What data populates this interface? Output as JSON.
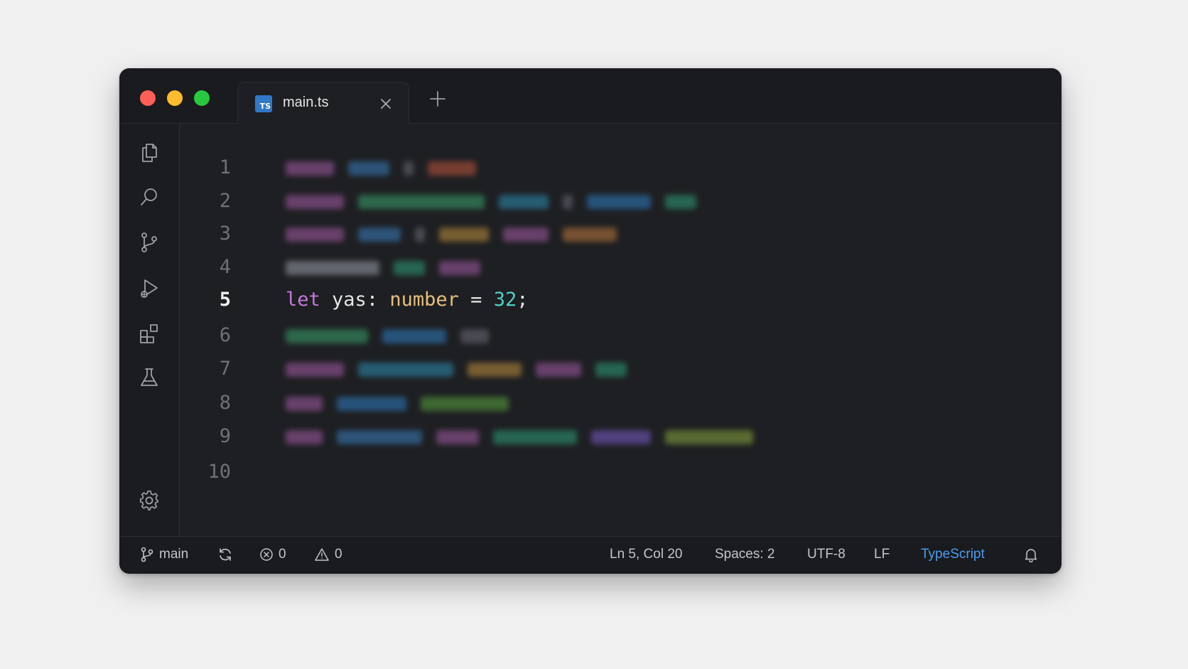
{
  "tab": {
    "title": "main.ts",
    "badge": "TS"
  },
  "editor": {
    "active_line": 5,
    "lines": [
      {
        "n": "1",
        "text": "",
        "blurred": true,
        "tokens": [
          [
            "#a55ca8",
            68
          ],
          [
            "#3a7fbf",
            58
          ],
          [
            "#6a6f7a",
            14
          ],
          [
            "#c0573e",
            68
          ]
        ]
      },
      {
        "n": "2",
        "text": "",
        "blurred": true,
        "tokens": [
          [
            "#a55ca8",
            82
          ],
          [
            "#3aa46e",
            178
          ],
          [
            "#2f8fb5",
            70
          ],
          [
            "#6a6f7a",
            14
          ],
          [
            "#2f7fc5",
            90
          ],
          [
            "#2ea07a",
            44
          ]
        ]
      },
      {
        "n": "3",
        "text": "",
        "blurred": true,
        "tokens": [
          [
            "#a55ca8",
            82
          ],
          [
            "#3a7fbf",
            60
          ],
          [
            "#6a6f7a",
            14
          ],
          [
            "#c0903e",
            70
          ],
          [
            "#a55ca8",
            64
          ],
          [
            "#c07a3e",
            76
          ]
        ]
      },
      {
        "n": "4",
        "text": "",
        "blurred": true,
        "tokens": [
          [
            "#9aa0aa",
            132
          ],
          [
            "#2ea07a",
            44
          ],
          [
            "#a55ca8",
            58
          ]
        ]
      },
      {
        "n": "5",
        "text": "let yas: number = 32;",
        "blurred": false
      },
      {
        "n": "6",
        "text": "",
        "blurred": true,
        "tokens": [
          [
            "#3aa46e",
            116
          ],
          [
            "#2f7fc5",
            90
          ],
          [
            "#6a6f7a",
            40
          ]
        ]
      },
      {
        "n": "7",
        "text": "",
        "blurred": true,
        "tokens": [
          [
            "#a55ca8",
            82
          ],
          [
            "#2f8fb5",
            134
          ],
          [
            "#c0903e",
            76
          ],
          [
            "#a55ca8",
            64
          ],
          [
            "#2ea07a",
            44
          ]
        ]
      },
      {
        "n": "8",
        "text": "",
        "blurred": true,
        "tokens": [
          [
            "#a55ca8",
            52
          ],
          [
            "#2f7fc5",
            98
          ],
          [
            "#5aa440",
            124
          ]
        ]
      },
      {
        "n": "9",
        "text": "",
        "blurred": true,
        "tokens": [
          [
            "#a55ca8",
            52
          ],
          [
            "#3a7fbf",
            120
          ],
          [
            "#a55ca8",
            60
          ],
          [
            "#2ea07a",
            118
          ],
          [
            "#7a5cc8",
            84
          ],
          [
            "#88a83e",
            124
          ]
        ]
      },
      {
        "n": "10",
        "text": "",
        "blurred": false
      }
    ]
  },
  "status": {
    "branch": "main",
    "errors": "0",
    "warnings": "0",
    "position": "Ln 5, Col 20",
    "spaces": "Spaces: 2",
    "encoding": "UTF-8",
    "eol": "LF",
    "language": "TypeScript"
  },
  "colors": {
    "keyword": "#c678dd",
    "identifier": "#e6e6e6",
    "type": "#e5c07b",
    "number": "#4fd1c5",
    "language": "#4d9bf0"
  },
  "icons": [
    "files-icon",
    "search-icon",
    "source-control-icon",
    "run-debug-icon",
    "extensions-icon",
    "testing-icon",
    "settings-gear-icon"
  ]
}
